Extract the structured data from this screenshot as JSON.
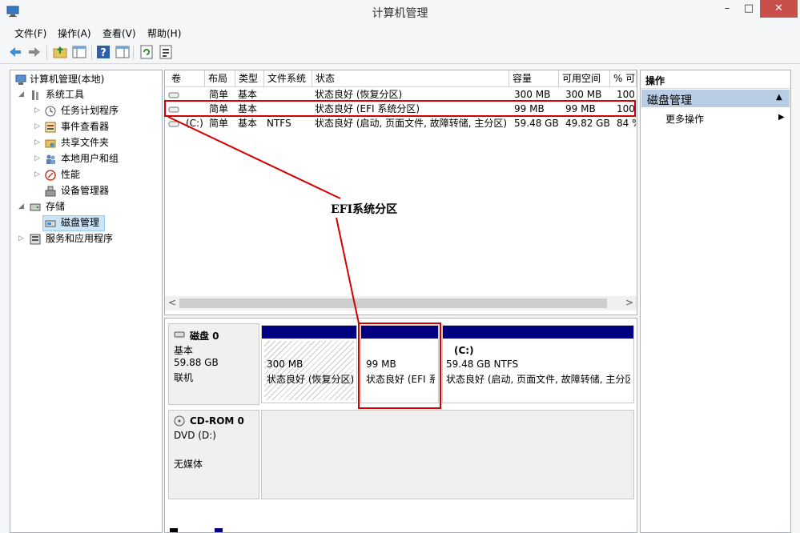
{
  "window": {
    "title": "计算机管理",
    "minimize": "–",
    "maximize": "□",
    "close": "✕"
  },
  "menu": [
    "文件(F)",
    "操作(A)",
    "查看(V)",
    "帮助(H)"
  ],
  "toolbar": {
    "back_icon": "arrow-left-icon",
    "forward_icon": "arrow-right-icon",
    "up_icon": "folder-up-icon",
    "tree_icon": "show-tree-icon",
    "help_icon": "help-icon",
    "props_icon": "properties-icon",
    "refresh_icon": "refresh-icon",
    "export_icon": "export-icon"
  },
  "tree": {
    "root": "计算机管理(本地)",
    "system_tools": "系统工具",
    "task_scheduler": "任务计划程序",
    "event_viewer": "事件查看器",
    "shared_folders": "共享文件夹",
    "local_users": "本地用户和组",
    "performance": "性能",
    "device_manager": "设备管理器",
    "storage": "存储",
    "disk_management": "磁盘管理",
    "services": "服务和应用程序"
  },
  "volume_table": {
    "headers": [
      "卷",
      "布局",
      "类型",
      "文件系统",
      "状态",
      "容量",
      "可用空间",
      "% 可"
    ],
    "rows": [
      {
        "vol": "",
        "layout": "简单",
        "type": "基本",
        "fs": "",
        "status": "状态良好 (恢复分区)",
        "capacity": "300 MB",
        "free": "300 MB",
        "pct": "100"
      },
      {
        "vol": "",
        "layout": "简单",
        "type": "基本",
        "fs": "",
        "status": "状态良好 (EFI 系统分区)",
        "capacity": "99 MB",
        "free": "99 MB",
        "pct": "100"
      },
      {
        "vol": "(C:)",
        "layout": "简单",
        "type": "基本",
        "fs": "NTFS",
        "status": "状态良好 (启动, 页面文件, 故障转储, 主分区)",
        "capacity": "59.48 GB",
        "free": "49.82 GB",
        "pct": "84 %"
      }
    ]
  },
  "annotation": {
    "label": "EFI系统分区",
    "highlight_color": "#d40000"
  },
  "disks": [
    {
      "name": "磁盘 0",
      "kind": "基本",
      "size": "59.88 GB",
      "state": "联机",
      "partitions": [
        {
          "title": "",
          "size": "300 MB",
          "status": "状态良好 (恢复分区)"
        },
        {
          "title": "",
          "size": "99 MB",
          "status": "状态良好 (EFI 系统分区)"
        },
        {
          "title": "(C:)",
          "size": "59.48 GB NTFS",
          "status": "状态良好 (启动, 页面文件, 故障转储, 主分区)"
        }
      ]
    },
    {
      "name": "CD-ROM 0",
      "kind": "DVD (D:)",
      "state": "无媒体"
    }
  ],
  "actions": {
    "header": "操作",
    "section": "磁盘管理",
    "more": "更多操作"
  },
  "colors": {
    "partition_bar": "#000080",
    "action_section_bg": "#b9cde4"
  }
}
